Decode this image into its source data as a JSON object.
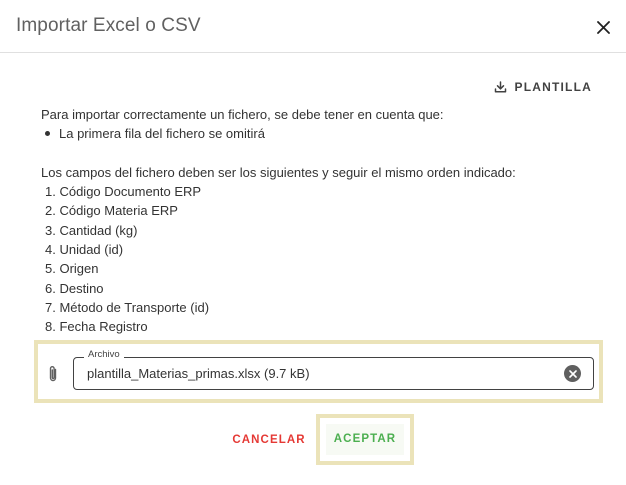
{
  "dialog": {
    "title": "Importar Excel o CSV",
    "close_icon": "close-icon"
  },
  "template_button": {
    "label": "PLANTILLA",
    "icon": "download-icon"
  },
  "instructions": {
    "intro": "Para importar correctamente un fichero, se debe tener en cuenta que:",
    "rules": [
      "La primera fila del fichero se omitirá"
    ],
    "fields_intro": "Los campos del fichero deben ser los siguientes y seguir el mismo orden indicado:",
    "fields": [
      "1. Código Documento ERP",
      "2. Código Materia ERP",
      "3. Cantidad (kg)",
      "4. Unidad (id)",
      "5. Origen",
      "6. Destino",
      "7. Método de Transporte (id)",
      "8. Fecha Registro"
    ]
  },
  "file_input": {
    "legend": "Archivo",
    "value": "plantilla_Materias_primas.xlsx (9.7 kB)",
    "prepend_icon": "paperclip-icon",
    "clear_icon": "clear-icon"
  },
  "actions": {
    "cancel_label": "CANCELAR",
    "accept_label": "ACEPTAR"
  },
  "colors": {
    "highlight": "#ebe3b9",
    "cancel": "#e53935",
    "accept": "#4caf50"
  }
}
